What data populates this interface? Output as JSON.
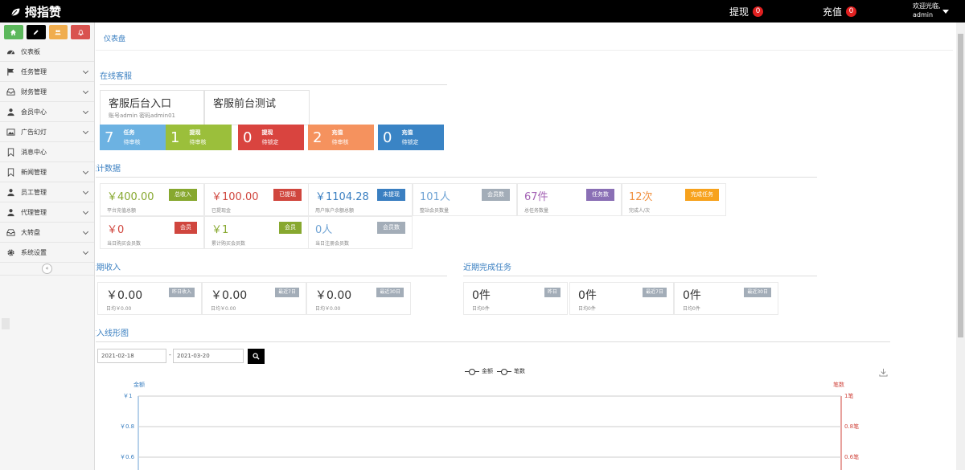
{
  "top": {
    "logo": "拇指赞",
    "withdraw_label": "提现",
    "withdraw_count": "0",
    "recharge_label": "充值",
    "recharge_count": "0",
    "welcome": "欢迎光临,",
    "user": "admin"
  },
  "sidebar": {
    "shortcuts": [
      {
        "icon": "home-icon",
        "color": "#5cb85c"
      },
      {
        "icon": "pencil-icon",
        "color": "#000000"
      },
      {
        "icon": "users-icon",
        "color": "#f0ad4e"
      },
      {
        "icon": "bell-icon",
        "color": "#d9534f"
      }
    ],
    "items": [
      {
        "label": "仪表板",
        "icon": "dashboard-icon"
      },
      {
        "label": "任务管理",
        "icon": "flag-icon"
      },
      {
        "label": "财务管理",
        "icon": "inbox-icon"
      },
      {
        "label": "会员中心",
        "icon": "user-icon"
      },
      {
        "label": "广告幻灯",
        "icon": "picture-icon"
      },
      {
        "label": "消息中心",
        "icon": "bookmark-icon"
      },
      {
        "label": "新闻管理",
        "icon": "bookmark-icon"
      },
      {
        "label": "员工管理",
        "icon": "user-icon"
      },
      {
        "label": "代理管理",
        "icon": "user-icon"
      },
      {
        "label": "大转盘",
        "icon": "inbox-icon"
      },
      {
        "label": "系统设置",
        "icon": "gear-icon"
      }
    ],
    "collapse": "«"
  },
  "page": {
    "breadcrumb": "仪表盘"
  },
  "online_service": {
    "title": "在线客服",
    "boxes": [
      {
        "title": "客服后台入口",
        "sub": "账号admin 密码admin01"
      },
      {
        "title": "客服前台测试",
        "sub": ""
      }
    ],
    "status": [
      {
        "num": "7",
        "line1": "任务",
        "line2": "待审核",
        "color": "#6cb2e2"
      },
      {
        "num": "1",
        "line1": "提现",
        "line2": "待审核",
        "color": "#9bbf3b"
      },
      {
        "num": "0",
        "line1": "提现",
        "line2": "待锁定",
        "color": "#d9443f"
      },
      {
        "num": "2",
        "line1": "充值",
        "line2": "待审核",
        "color": "#f5925e"
      },
      {
        "num": "0",
        "line1": "充值",
        "line2": "待锁定",
        "color": "#3a84c5"
      }
    ]
  },
  "stats": {
    "title": "统计数据",
    "cards": [
      {
        "value": "￥400.00",
        "label": "平台充值总额",
        "tag": "总收入",
        "value_color": "#87a82f",
        "tag_color": "#87a82f"
      },
      {
        "value": "￥100.00",
        "label": "已提现金",
        "tag": "已提现",
        "value_color": "#d0463e",
        "tag_color": "#d0463e"
      },
      {
        "value": "￥1104.28",
        "label": "用户账户余额总额",
        "tag": "未提现",
        "value_color": "#3a7fc1",
        "tag_color": "#3a7fc1"
      },
      {
        "value": "101人",
        "label": "整站会员数量",
        "tag": "会员数",
        "value_color": "#6fa3d4",
        "tag_color": "#a3adb8"
      },
      {
        "value": "67件",
        "label": "总任务数量",
        "tag": "任务数",
        "value_color": "#a463b5",
        "tag_color": "#8a6fb5"
      },
      {
        "value": "12次",
        "label": "完成人/次",
        "tag": "完成任务",
        "value_color": "#f0903f",
        "tag_color": "#f7a21d"
      },
      {
        "value": "￥0",
        "label": "当日购买会员数",
        "tag": "会员",
        "value_color": "#d0463e",
        "tag_color": "#d0463e"
      },
      {
        "value": "￥1",
        "label": "累计购买会员数",
        "tag": "会员",
        "value_color": "#87a82f",
        "tag_color": "#87a82f"
      },
      {
        "value": "0人",
        "label": "当日注册会员数",
        "tag": "会员数",
        "value_color": "#6fa3d4",
        "tag_color": "#a3adb8"
      }
    ]
  },
  "income": {
    "title": "近期收入",
    "cards": [
      {
        "value": "￥0.00",
        "label": "日均￥0.00",
        "tag": "昨日收入"
      },
      {
        "value": "￥0.00",
        "label": "日均￥0.00",
        "tag": "最近7日"
      },
      {
        "value": "￥0.00",
        "label": "日均￥0.00",
        "tag": "最近30日"
      }
    ]
  },
  "tasks": {
    "title": "近期完成任务",
    "cards": [
      {
        "value": "0件",
        "label": "日均0件",
        "tag": "昨日"
      },
      {
        "value": "0件",
        "label": "日均0件",
        "tag": "最近7日"
      },
      {
        "value": "0件",
        "label": "日均0件",
        "tag": "最近30日"
      }
    ]
  },
  "chart_section": {
    "title": "收入线形图",
    "date_from": "2021-02-18",
    "date_sep": "-",
    "date_to": "2021-03-20"
  },
  "chart_data": {
    "type": "line",
    "series": [
      {
        "name": "金额",
        "values": []
      },
      {
        "name": "笔数",
        "values": []
      }
    ],
    "ylabel_left": "金额",
    "ylabel_right": "笔数",
    "left_ticks": [
      "￥1",
      "￥0.8",
      "￥0.6"
    ],
    "right_ticks": [
      "1笔",
      "0.8笔",
      "0.6笔"
    ],
    "left_axis_color": "#3a7fc1",
    "right_axis_color": "#d0463e"
  }
}
